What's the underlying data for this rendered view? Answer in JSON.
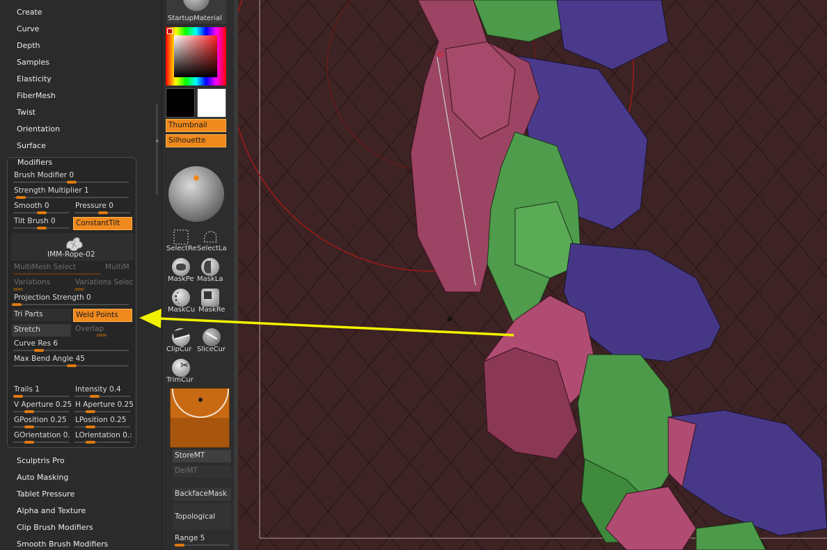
{
  "left_menu_top": [
    "Create",
    "Curve",
    "Depth",
    "Samples",
    "Elasticity",
    "FiberMesh",
    "Twist",
    "Orientation",
    "Surface"
  ],
  "modifiers": {
    "title": "Modifiers",
    "brush_modifier": "Brush Modifier 0",
    "strength_multiplier": "Strength Multiplier 1",
    "smooth": "Smooth 0",
    "pressure": "Pressure 0",
    "tilt_brush": "Tilt Brush 0",
    "constant_tilt": "ConstantTilt",
    "imm_label": "IMM-Rope-02",
    "multimesh_select": "MultiMesh Select",
    "multim": "MultiM",
    "variations": "Variations",
    "variations_select": "Variations Selec",
    "projection_strength": "Projection Strength 0",
    "tri_parts": "Tri Parts",
    "weld_points": "Weld Points",
    "stretch": "Stretch",
    "overlap": "Overlap",
    "curve_res": "Curve Res 6",
    "max_bend_angle": "Max Bend Angle 45",
    "trails": "Trails 1",
    "intensity": "Intensity 0.4",
    "v_aperture": "V Aperture 0.25",
    "h_aperture": "H Aperture 0.25",
    "gposition": "GPosition 0.25",
    "lposition": "LPosition 0.25",
    "gorientation": "GOrientation 0.",
    "lorientation": "LOrientation 0.:"
  },
  "left_menu_bottom": [
    "Sculptris Pro",
    "Auto Masking",
    "Tablet Pressure",
    "Alpha and Texture",
    "Clip Brush Modifiers",
    "Smooth Brush Modifiers"
  ],
  "tools": {
    "material": "StartupMaterial",
    "thumbnail": "Thumbnail",
    "silhouette": "Silhouette",
    "select_rect": "SelectRe",
    "select_lasso": "SelectLa",
    "mask_pen": "MaskPe",
    "mask_lasso": "MaskLa",
    "mask_curve": "MaskCu",
    "mask_rect": "MaskRe",
    "clip_curve": "ClipCur",
    "slice_curve": "SliceCur",
    "trim_curve": "TrimCur",
    "store_mt": "StoreMT",
    "del_mt": "DelMT",
    "backface_mask": "BackfaceMask",
    "topological": "Topological",
    "range": "Range 5"
  },
  "colors": {
    "accent_orange": "#f08a1e",
    "annotation_arrow": "#f2f200",
    "viewport_bg": "#3d2323",
    "mesh_pink": "#a84868",
    "mesh_purple": "#4a3888",
    "mesh_green": "#4a9a48"
  },
  "icons": [
    "color-picker-icon",
    "brush-sphere-icon",
    "select-rect-icon",
    "select-lasso-icon",
    "mask-pen-icon",
    "mask-lasso-icon",
    "mask-curve-icon",
    "mask-rect-icon",
    "clip-curve-icon",
    "slice-curve-icon",
    "trim-curve-icon",
    "alpha-preview-icon"
  ]
}
